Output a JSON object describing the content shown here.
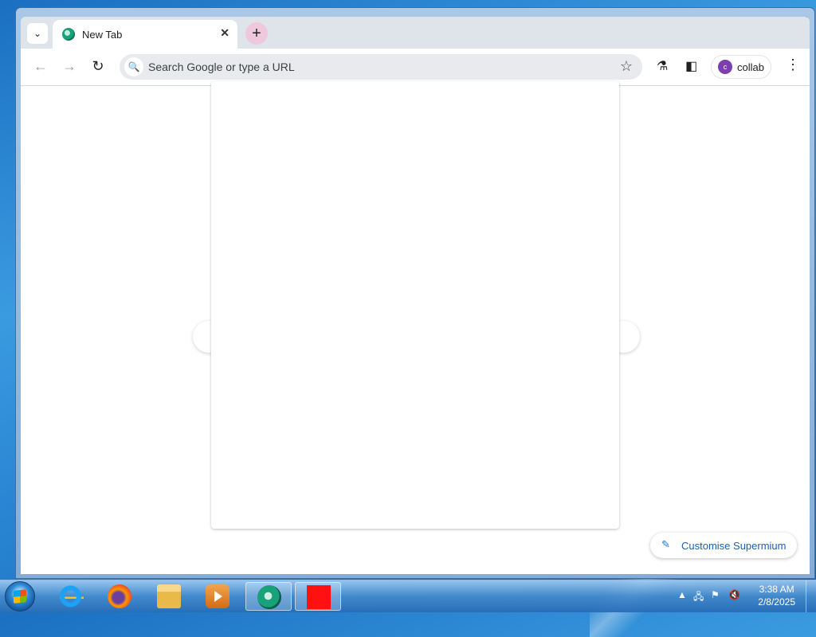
{
  "browser": {
    "tab": {
      "title": "New Tab",
      "close": "✕"
    },
    "new_tab": "+",
    "tab_search": "⌄",
    "omnibox": {
      "placeholder": "Search Google or type a URL"
    },
    "profile": {
      "initial": "c",
      "name": "collab"
    },
    "customise_label": "Customise Supermium"
  },
  "window_controls": {
    "minimize": "▁",
    "maximize": "□",
    "close": "✕"
  },
  "taskbar": {
    "apps": [
      {
        "name": "internet-explorer"
      },
      {
        "name": "firefox"
      },
      {
        "name": "file-explorer"
      },
      {
        "name": "media-player"
      },
      {
        "name": "supermium",
        "active": true
      },
      {
        "name": "red-app"
      }
    ],
    "clock": {
      "time": "3:38 AM",
      "date": "2/8/2025"
    }
  }
}
